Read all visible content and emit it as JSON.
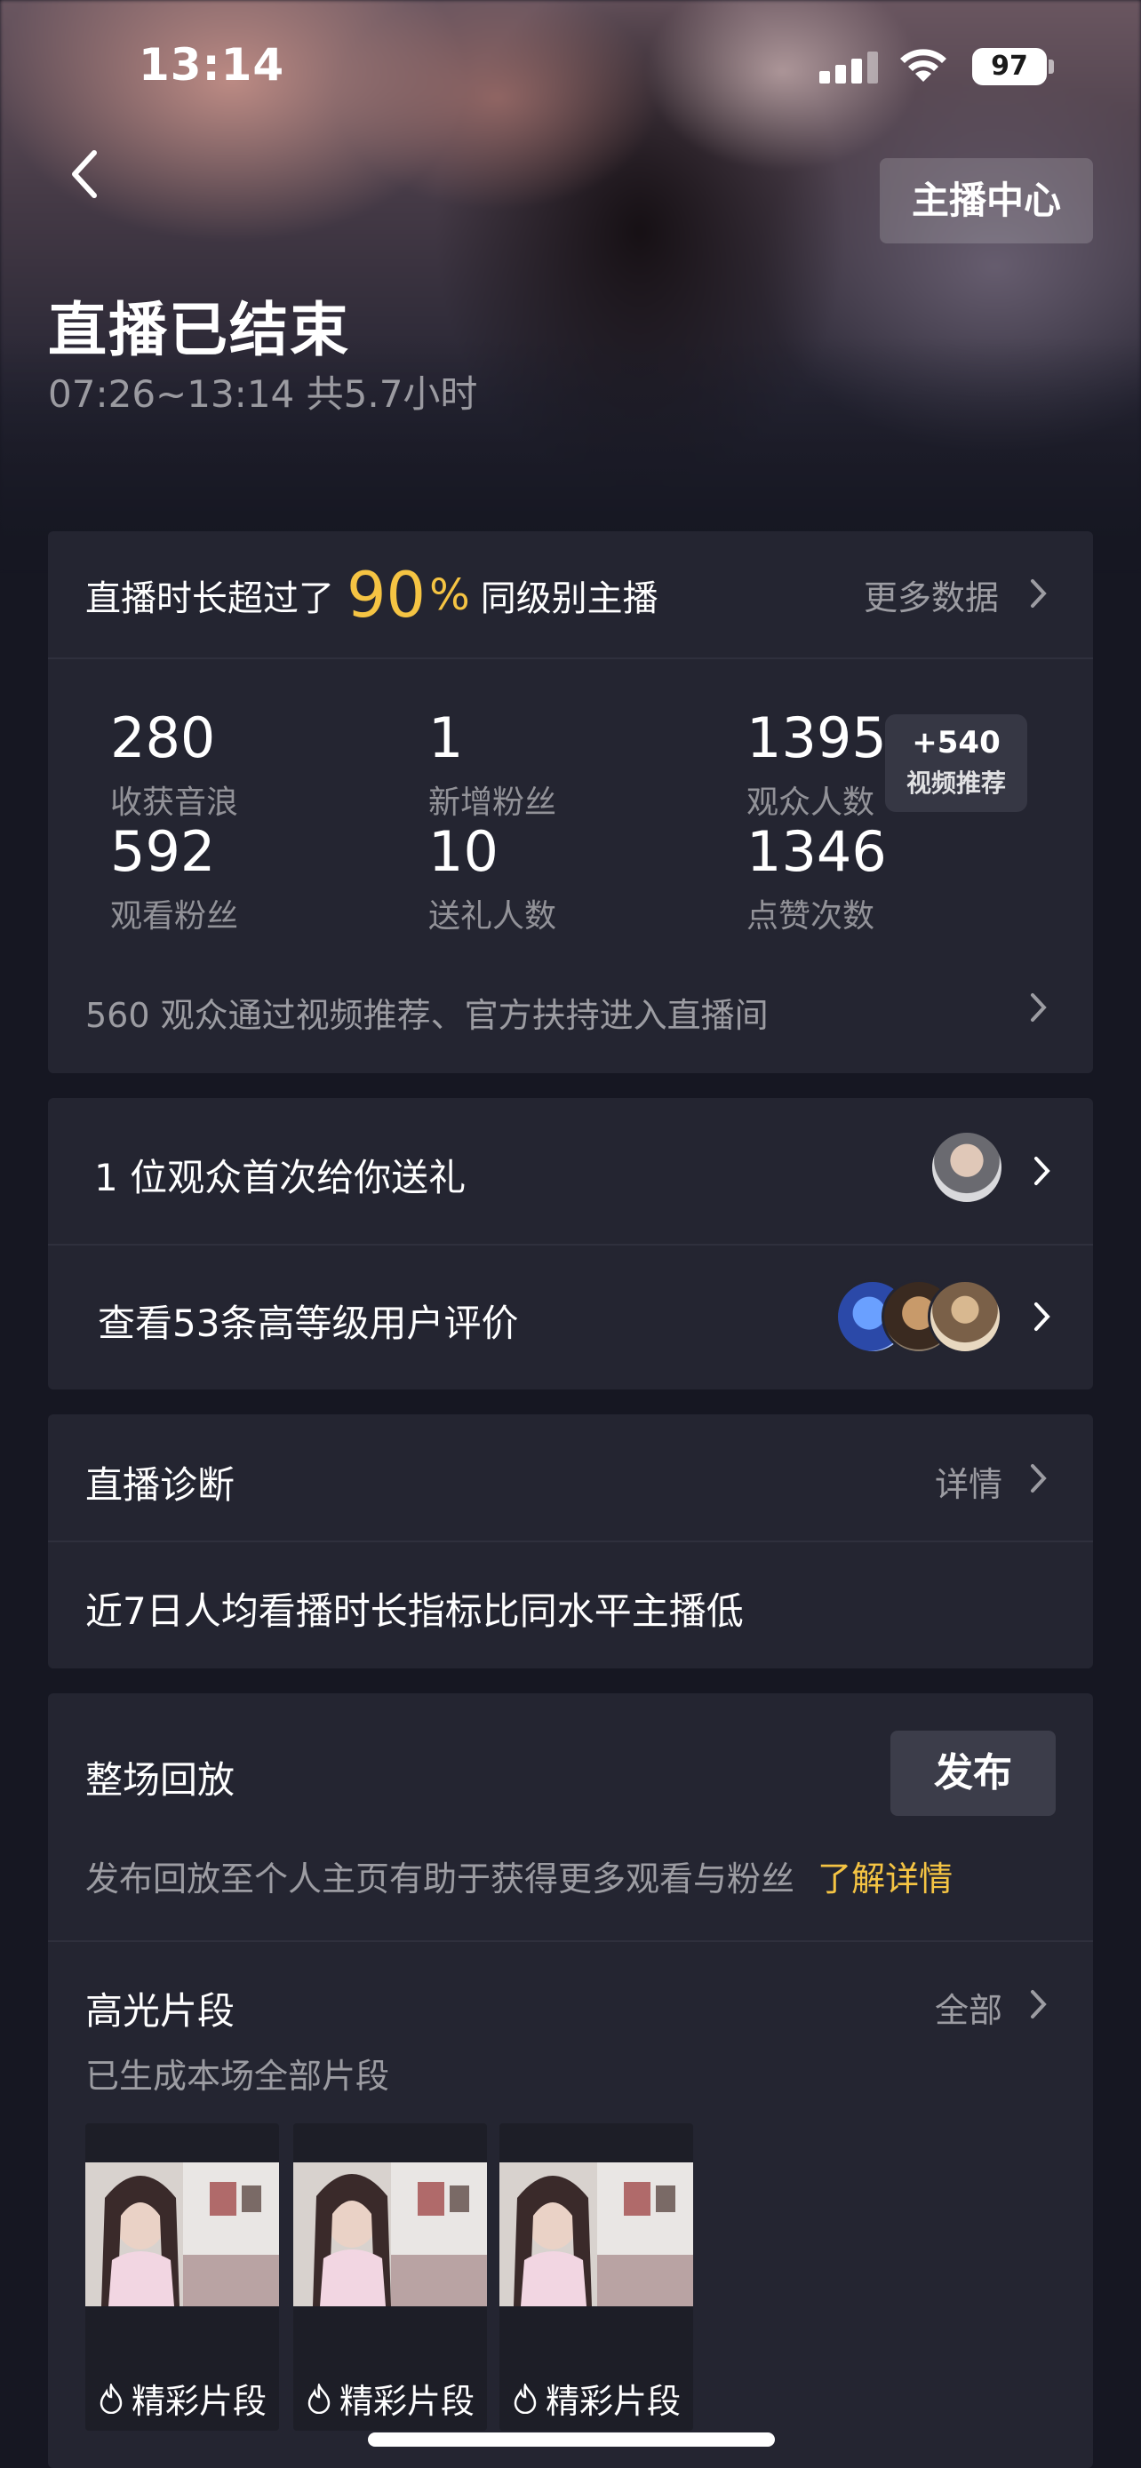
{
  "status_bar": {
    "time": "13:14",
    "battery": "97"
  },
  "header": {
    "anchor_center": "主播中心",
    "title": "直播已结束",
    "subtitle": "07:26~13:14 共5.7小时"
  },
  "summary": {
    "prefix": "直播时长超过了",
    "percent": "90",
    "percent_sign": "%",
    "suffix": "同级别主播",
    "more": "更多数据"
  },
  "stats": [
    {
      "value": "280",
      "label": "收获音浪"
    },
    {
      "value": "1",
      "label": "新增粉丝"
    },
    {
      "value": "1395",
      "label": "观众人数"
    },
    {
      "value": "592",
      "label": "观看粉丝"
    },
    {
      "value": "10",
      "label": "送礼人数"
    },
    {
      "value": "1346",
      "label": "点赞次数"
    }
  ],
  "promo_badge": {
    "count": "+540",
    "label": "视频推荐"
  },
  "traffic_note": "560 观众通过视频推荐、官方扶持进入直播间",
  "gifts_row": {
    "text": "1 位观众首次给你送礼"
  },
  "reviews_row": {
    "text": "查看53条高等级用户评价"
  },
  "diagnosis": {
    "title": "直播诊断",
    "detail": "详情",
    "message": "近7日人均看播时长指标比同水平主播低"
  },
  "replay": {
    "title": "整场回放",
    "publish": "发布",
    "hint": "发布回放至个人主页有助于获得更多观看与粉丝",
    "learn_more": "了解详情"
  },
  "highlights": {
    "title": "高光片段",
    "all": "全部",
    "subtitle": "已生成本场全部片段",
    "clips": [
      {
        "label": "精彩片段"
      },
      {
        "label": "精彩片段"
      },
      {
        "label": "精彩片段"
      }
    ]
  },
  "colors": {
    "accent_gold": "#f5c443",
    "card_bg": "#242531",
    "page_bg": "#161722"
  }
}
